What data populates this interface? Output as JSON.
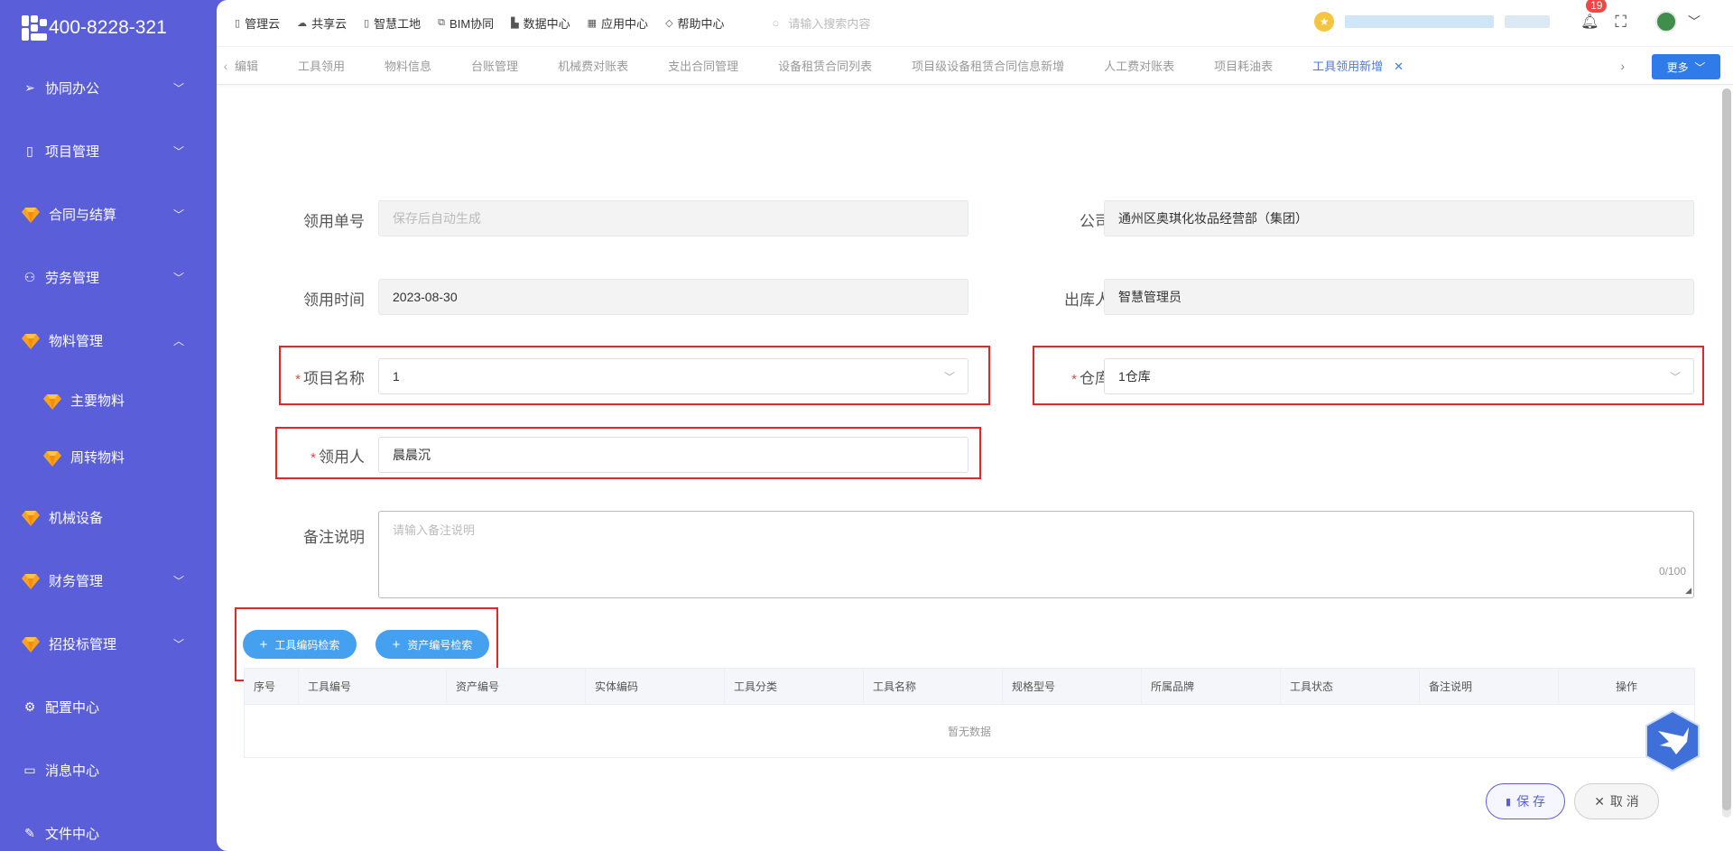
{
  "sidebar": {
    "logo_text": "400-8228-321",
    "items": [
      {
        "label": "协同办公",
        "icon": "send-icon",
        "has_chevron": true,
        "chevron": "﹀"
      },
      {
        "label": "项目管理",
        "icon": "book-icon",
        "has_chevron": true,
        "chevron": "﹀"
      },
      {
        "label": "合同与结算",
        "icon": "gem-icon",
        "has_chevron": true,
        "chevron": "﹀"
      },
      {
        "label": "劳务管理",
        "icon": "user-icon",
        "has_chevron": true,
        "chevron": "﹀"
      },
      {
        "label": "物料管理",
        "icon": "gem-icon",
        "has_chevron": true,
        "chevron": "︿",
        "expanded": true
      },
      {
        "label": "主要物料",
        "icon": "gem-icon",
        "sub": true
      },
      {
        "label": "周转物料",
        "icon": "gem-icon",
        "sub": true
      },
      {
        "label": "机械设备",
        "icon": "gem-icon",
        "has_chevron": false
      },
      {
        "label": "财务管理",
        "icon": "gem-icon",
        "has_chevron": true,
        "chevron": "﹀"
      },
      {
        "label": "招投标管理",
        "icon": "gem-icon",
        "has_chevron": true,
        "chevron": "﹀"
      },
      {
        "label": "配置中心",
        "icon": "gear-icon",
        "has_chevron": false
      },
      {
        "label": "消息中心",
        "icon": "message-icon",
        "has_chevron": false
      },
      {
        "label": "文件中心",
        "icon": "file-edit-icon",
        "has_chevron": false
      }
    ]
  },
  "topnav": {
    "items": [
      "管理云",
      "共享云",
      "智慧工地",
      "BIM协同",
      "数据中心",
      "应用中心",
      "帮助中心"
    ],
    "search_placeholder": "请输入搜索内容",
    "notification_count": "19"
  },
  "tabs": {
    "items": [
      "编辑",
      "工具领用",
      "物料信息",
      "台账管理",
      "机械费对账表",
      "支出合同管理",
      "设备租赁合同列表",
      "项目级设备租赁合同信息新增",
      "人工费对账表",
      "项目耗油表",
      "工具领用新增"
    ],
    "active_index": 10,
    "more_label": "更多"
  },
  "form": {
    "order_no_label": "领用单号",
    "order_no_placeholder": "保存后自动生成",
    "company_label": "公司",
    "company_value": "通州区奥琪化妆品经营部（集团）",
    "time_label": "领用时间",
    "time_value": "2023-08-30",
    "outbound_label": "出库人",
    "outbound_value": "智慧管理员",
    "project_label": "项目名称",
    "project_value": "1",
    "warehouse_label": "仓库",
    "warehouse_value": "1仓库",
    "receiver_label": "领用人",
    "receiver_value": "晨晨沉",
    "remark_label": "备注说明",
    "remark_placeholder": "请输入备注说明",
    "remark_counter": "0/100",
    "required_mark": "*"
  },
  "buttons": {
    "tool_code_search": "工具编码检索",
    "asset_code_search": "资产编号检索",
    "save": "保 存",
    "cancel": "取 消"
  },
  "table": {
    "headers": [
      "序号",
      "工具编号",
      "资产编号",
      "实体编码",
      "工具分类",
      "工具名称",
      "规格型号",
      "所属品牌",
      "工具状态",
      "备注说明",
      "操作"
    ],
    "empty_text": "暂无数据"
  },
  "colors": {
    "sidebar_bg": "#5a5fd9",
    "accent": "#4a7ae8",
    "highlight_red": "#e82424",
    "pill_blue": "#45a0f0"
  }
}
